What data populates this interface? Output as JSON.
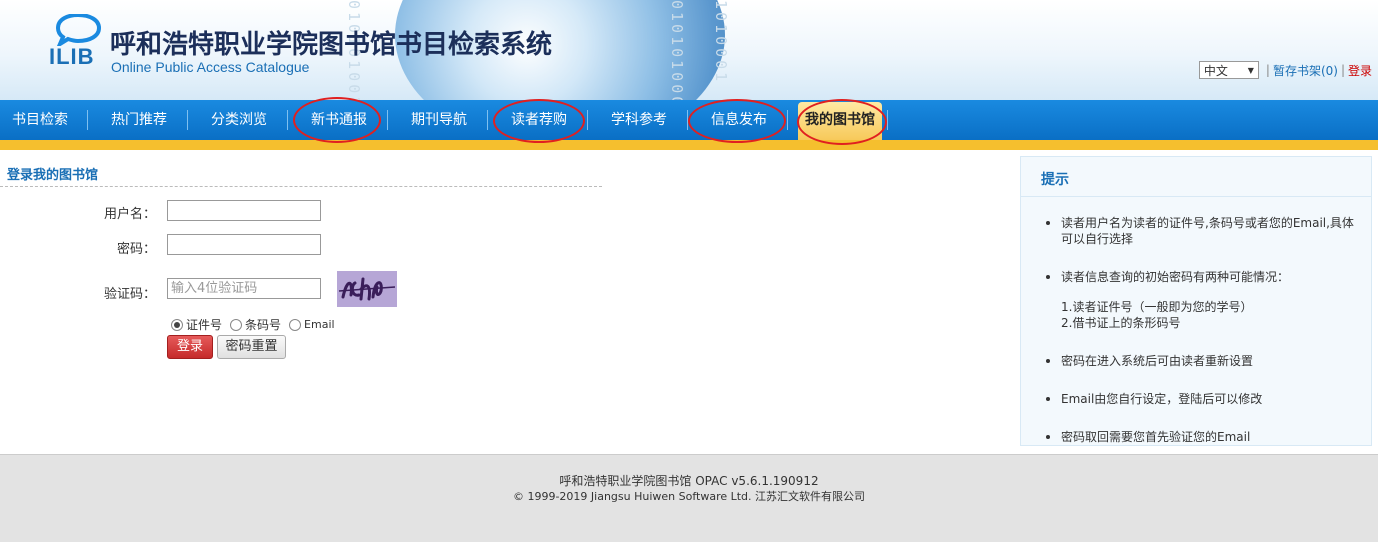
{
  "header": {
    "logo_text": "ILIB",
    "title": "呼和浩特职业学院图书馆书目检索系统",
    "subtitle": "Online Public Access Catalogue",
    "language": "中文",
    "shelf_link": "暂存书架(0)",
    "login_link": "登录",
    "separator": "|"
  },
  "nav": {
    "items": [
      "书目检索",
      "热门推荐",
      "分类浏览",
      "新书通报",
      "期刊导航",
      "读者荐购",
      "学科参考",
      "信息发布",
      "我的图书馆"
    ],
    "active_index": 8,
    "highlighted_indices": [
      3,
      5,
      7,
      8
    ],
    "highlight_color": "#e02020",
    "active_color": "#f7c95a"
  },
  "login": {
    "title": "登录我的图书馆",
    "username_label": "用户名：",
    "password_label": "密码：",
    "captcha_label": "验证码：",
    "captcha_placeholder": "输入4位验证码",
    "radio_options": [
      "证件号",
      "条码号",
      "Email"
    ],
    "radio_selected": 0,
    "login_button": "登录",
    "reset_button": "密码重置"
  },
  "tips": {
    "title": "提示",
    "items": [
      "读者用户名为读者的证件号,条码号或者您的Email,具体可以自行选择",
      "读者信息查询的初始密码有两种可能情况：",
      "1.读者证件号（一般即为您的学号）",
      "2.借书证上的条形码号",
      "密码在进入系统后可由读者重新设置",
      "Email由您自行设定，登陆后可以修改",
      "密码取回需要您首先验证您的Email"
    ]
  },
  "footer": {
    "line1": "呼和浩特职业学院图书馆   OPAC v5.6.1.190912",
    "line2": "© 1999-2019 Jiangsu Huiwen Software Ltd. 江苏汇文软件有限公司"
  },
  "decor": {
    "binary_strings": [
      "010101001",
      "0101010001",
      "1010001"
    ]
  }
}
